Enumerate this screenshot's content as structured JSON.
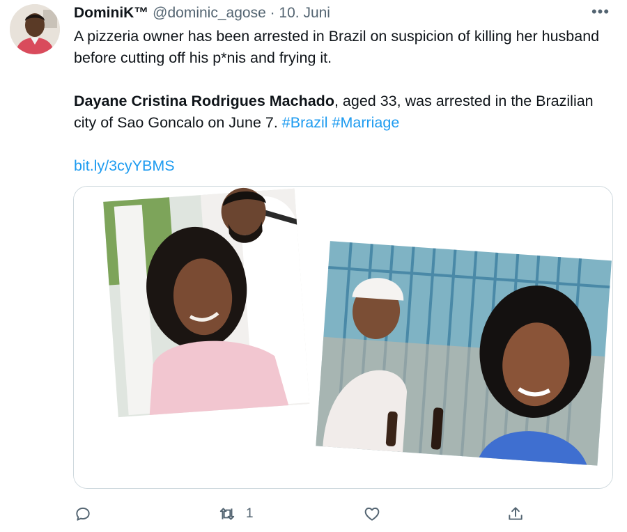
{
  "tweet": {
    "author_name": "DominiK™",
    "handle": "@dominic_agose",
    "separator": " · ",
    "date": "10. Juni",
    "more_label": "•••",
    "line1": "A pizzeria owner has been arrested in Brazil on suspicion of killing her husband before cutting off his p*nis and frying it.",
    "bold_name": "Dayane Cristina Rodrigues Machado",
    "line2_rest": ", aged 33, was arrested in the Brazilian city of Sao Goncalo on June 7.  ",
    "hashtags": [
      "#Brazil",
      "#Marriage"
    ],
    "link": "bit.ly/3cyYBMS"
  },
  "actions": {
    "reply_icon": "reply-icon",
    "retweet_icon": "retweet-icon",
    "retweet_count": "1",
    "like_icon": "heart-icon",
    "share_icon": "share-icon"
  },
  "colors": {
    "link": "#1d9bf0",
    "muted": "#536471",
    "text": "#0f1419",
    "border": "#cfd9de"
  }
}
